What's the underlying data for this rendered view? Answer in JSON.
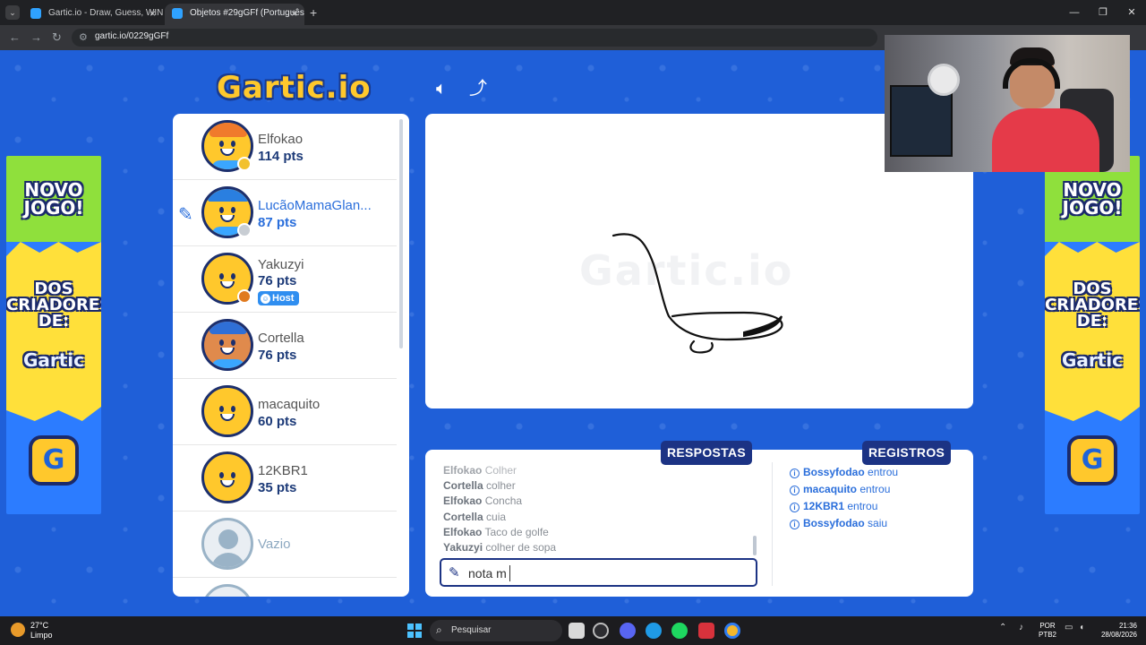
{
  "browser": {
    "tabs": [
      {
        "title": "Gartic.io - Draw, Guess, WIN"
      },
      {
        "title": "Objetos #29gGFf (Português) -"
      }
    ],
    "url": "gartic.io/0229gGFf"
  },
  "game": {
    "logo": "Gartic.io",
    "watermark": "Gartic.io",
    "timer_fraction": 0.75
  },
  "banners": {
    "novo": "NOVO JOGO!",
    "dos": "DOS CRIADORES DE:",
    "gartic": "Gartic",
    "g": "G"
  },
  "players": [
    {
      "name": "Elfokao",
      "points": "114 pts",
      "status_color": "#f2c12e"
    },
    {
      "name": "LucãoMamaGlan...",
      "points": "87 pts",
      "status_color": "#c8cdd3",
      "drawing": true
    },
    {
      "name": "Yakuzyi",
      "points": "76 pts",
      "status_color": "#e07a1f",
      "host_label": "Host"
    },
    {
      "name": "Cortella",
      "points": "76 pts"
    },
    {
      "name": "macaquito",
      "points": "60 pts"
    },
    {
      "name": "12KBR1",
      "points": "35 pts"
    },
    {
      "name": "Vazio"
    }
  ],
  "answers_panel": {
    "tab_label": "RESPOSTAS",
    "messages": [
      {
        "user": "Elfokao",
        "text": "Colher"
      },
      {
        "user": "Cortella",
        "text": "colher"
      },
      {
        "user": "Elfokao",
        "text": "Concha"
      },
      {
        "user": "Cortella",
        "text": "cuia"
      },
      {
        "user": "Elfokao",
        "text": "Taco de golfe"
      },
      {
        "user": "Yakuzyi",
        "text": "colher de sopa"
      }
    ],
    "input_value": "nota m"
  },
  "logs_panel": {
    "tab_label": "REGISTROS",
    "entries": [
      {
        "user": "Bossyfodao",
        "action": "entrou"
      },
      {
        "user": "macaquito",
        "action": "entrou"
      },
      {
        "user": "12KBR1",
        "action": "entrou"
      },
      {
        "user": "Bossyfodao",
        "action": "saiu"
      }
    ]
  },
  "taskbar": {
    "weather_temp": "27°C",
    "weather_desc": "Limpo",
    "search_placeholder": "Pesquisar",
    "lang_1": "POR",
    "lang_2": "PTB2",
    "time": "21:36",
    "date": "28/08/2026"
  }
}
